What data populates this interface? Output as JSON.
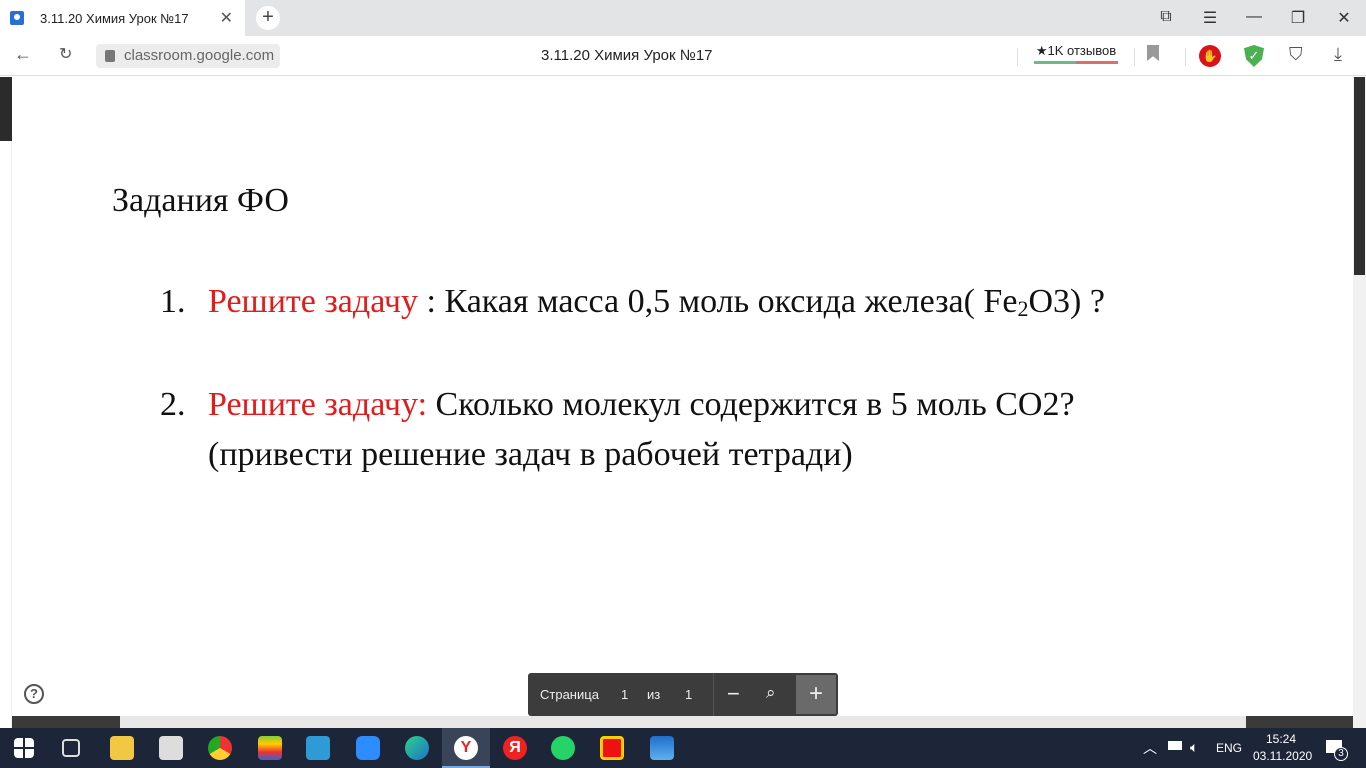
{
  "browser": {
    "tab_title": "3.11.20 Химия Урок №17",
    "url": "classroom.google.com",
    "page_title": "3.11.20 Химия Урок №17",
    "reviews": "★1K отзывов"
  },
  "doc": {
    "heading": "Задания ФО",
    "items": [
      {
        "num": "1.",
        "label": "Решите задачу",
        "rest": " : Какая  масса 0,5 моль  оксида железа( Fe",
        "sub": "2",
        "rest2": "O3) ?"
      },
      {
        "num": "2.",
        "label": "Решите задачу:",
        "rest": "  Сколько молекул содержится в 5 моль  CO2?",
        "line2": "(привести решение задач в рабочей тетради)"
      }
    ]
  },
  "pager": {
    "page_label": "Страница",
    "current": "1",
    "of_label": "из",
    "total": "1"
  },
  "tray": {
    "lang": "ENG",
    "time": "15:24",
    "date": "03.11.2020",
    "notifications": "3"
  }
}
